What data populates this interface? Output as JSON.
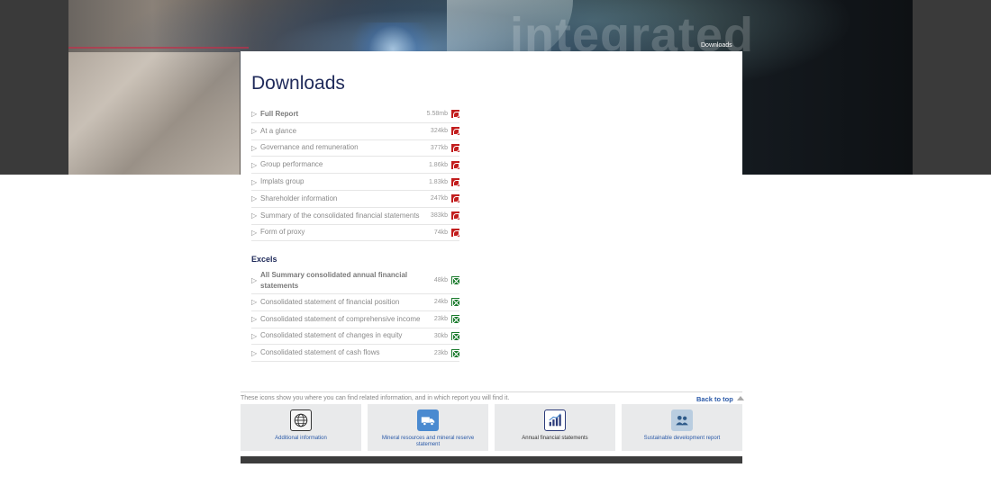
{
  "hero": {
    "word": "integrated",
    "breadcrumb": "Downloads"
  },
  "page": {
    "title": "Downloads"
  },
  "pdf_items": [
    {
      "label": "Full Report",
      "size": "5.58mb",
      "bold": true
    },
    {
      "label": "At a glance",
      "size": "324kb"
    },
    {
      "label": "Governance and remuneration",
      "size": "377kb"
    },
    {
      "label": "Group performance",
      "size": "1.86kb"
    },
    {
      "label": "Implats group",
      "size": "1.83kb"
    },
    {
      "label": "Shareholder information",
      "size": "247kb"
    },
    {
      "label": "Summary of the consolidated financial statements",
      "size": "383kb"
    },
    {
      "label": "Form of proxy",
      "size": "74kb"
    }
  ],
  "excels": {
    "heading": "Excels",
    "items": [
      {
        "label": "All Summary consolidated annual financial statements",
        "size": "48kb",
        "bold": true
      },
      {
        "label": "Consolidated statement of financial position",
        "size": "24kb"
      },
      {
        "label": "Consolidated statement of comprehensive income",
        "size": "23kb"
      },
      {
        "label": "Consolidated statement of changes in equity",
        "size": "30kb"
      },
      {
        "label": "Consolidated statement of cash flows",
        "size": "23kb"
      }
    ]
  },
  "legend": {
    "text": "These icons show you where you can find related information, and in which report you will find it.",
    "back_to_top": "Back to top"
  },
  "tiles": [
    {
      "label": "Additional information",
      "icon": "globe-icon"
    },
    {
      "label": "Mineral resources and mineral reserve statement",
      "icon": "truck-icon"
    },
    {
      "label": "Annual financial statements",
      "icon": "chart-icon"
    },
    {
      "label": "Sustainable development report",
      "icon": "people-icon"
    }
  ],
  "colors": {
    "title": "#1f2a5a",
    "link": "#2b5aa8",
    "pdf": "#c21d1d",
    "excel": "#1a7a2c"
  }
}
